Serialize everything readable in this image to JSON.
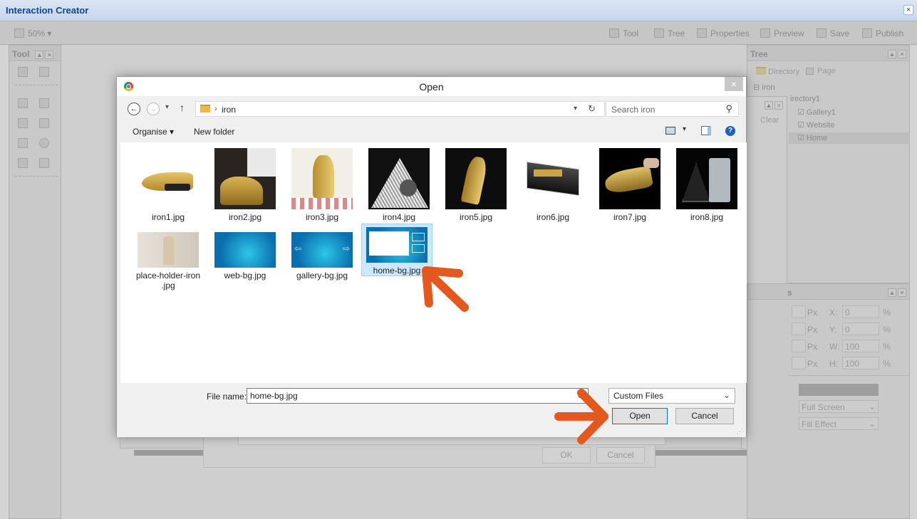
{
  "app": {
    "title": "Interaction Creator",
    "close": "×"
  },
  "toolbar": {
    "zoom": "50% ▾",
    "items": [
      "Tool",
      "Tree",
      "Properties",
      "Preview",
      "Save",
      "Publish"
    ]
  },
  "left_panel": {
    "title": "Tool"
  },
  "tree_panel": {
    "title": "Tree",
    "tabs": [
      "Directory",
      "Page"
    ],
    "nodes": [
      "iron",
      "irectory1",
      "Gallery1",
      "Website",
      "Home"
    ],
    "clear": "Clear"
  },
  "props_panel": {
    "title": "s",
    "rows": [
      [
        "Px",
        "X:",
        "0",
        "%"
      ],
      [
        "Px",
        "Y:",
        "0",
        "%"
      ],
      [
        "Px",
        "W:",
        "100",
        "%"
      ],
      [
        "Px",
        "H:",
        "100",
        "%"
      ]
    ],
    "select1": "Full Screen",
    "select2": "Fill Effect"
  },
  "under_dialog": {
    "ok": "OK",
    "cancel": "Cancel"
  },
  "dialog": {
    "title": "Open",
    "close": "×",
    "path": "iron",
    "search_placeholder": "Search iron",
    "organise": "Organise ▾",
    "new_folder": "New folder",
    "files": [
      {
        "name": "iron1.jpg"
      },
      {
        "name": "iron2.jpg"
      },
      {
        "name": "iron3.jpg"
      },
      {
        "name": "iron4.jpg"
      },
      {
        "name": "iron5.jpg"
      },
      {
        "name": "iron6.jpg"
      },
      {
        "name": "iron7.jpg"
      },
      {
        "name": "iron8.jpg"
      },
      {
        "name": "place-holder-iron .jpg"
      },
      {
        "name": "web-bg.jpg"
      },
      {
        "name": "gallery-bg.jpg"
      },
      {
        "name": "home-bg.jpg",
        "selected": true
      }
    ],
    "filename_label": "File name:",
    "filename_value": "home-bg.jpg",
    "filter": "Custom Files",
    "open": "Open",
    "cancel": "Cancel"
  },
  "annotation_color": "#e2581d"
}
